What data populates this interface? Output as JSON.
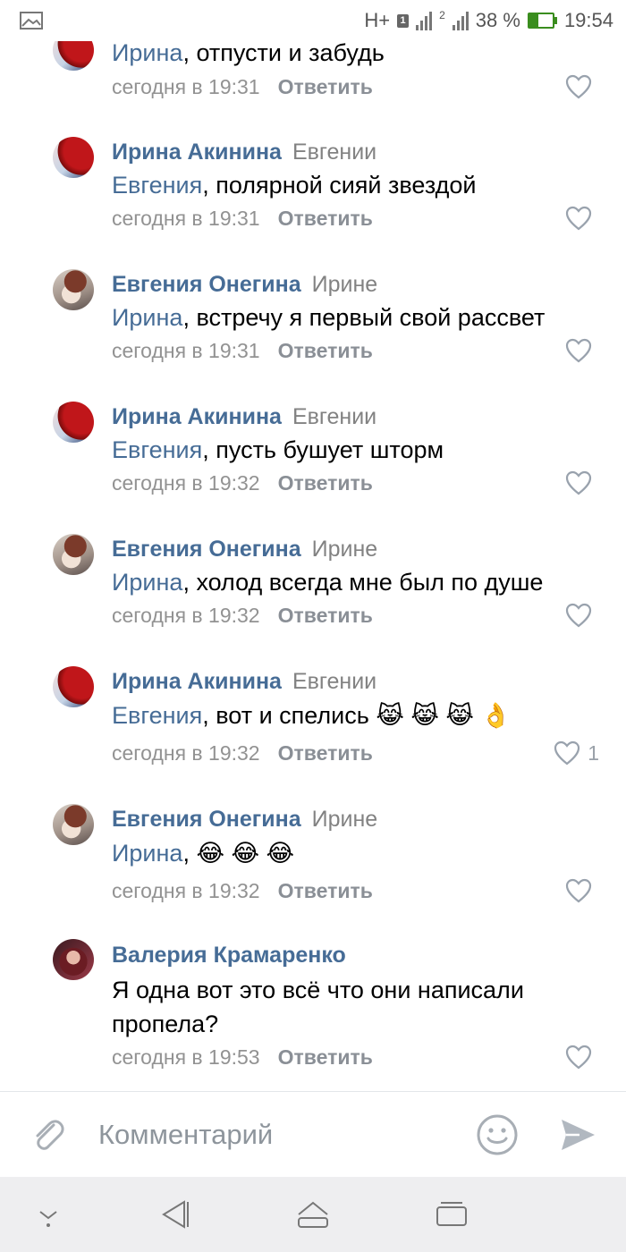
{
  "status_bar": {
    "network": "H+",
    "sim1_badge": "1",
    "sim2_label": "2",
    "battery_percent": "38 %",
    "time": "19:54",
    "icons": [
      "image-icon",
      "signal-icon",
      "battery-charging-icon"
    ]
  },
  "comments": [
    {
      "author": "",
      "addressee": "",
      "mention": "Ирина",
      "text": ", отпусти и забудь",
      "time": "сегодня в 19:31",
      "reply": "Ответить",
      "likes": "",
      "avatar": "irina"
    },
    {
      "author": "Ирина Акинина",
      "addressee": "Евгении",
      "mention": "Евгения",
      "text": ", полярной сияй звездой",
      "time": "сегодня в 19:31",
      "reply": "Ответить",
      "likes": "",
      "avatar": "irina"
    },
    {
      "author": "Евгения Онегина",
      "addressee": "Ирине",
      "mention": "Ирина",
      "text": ", встречу я первый свой рассвет",
      "time": "сегодня в 19:31",
      "reply": "Ответить",
      "likes": "",
      "avatar": "evgenia"
    },
    {
      "author": "Ирина Акинина",
      "addressee": "Евгении",
      "mention": "Евгения",
      "text": ", пусть бушует шторм",
      "time": "сегодня в 19:32",
      "reply": "Ответить",
      "likes": "",
      "avatar": "irina"
    },
    {
      "author": "Евгения Онегина",
      "addressee": "Ирине",
      "mention": "Ирина",
      "text": ", холод всегда мне был по душе",
      "time": "сегодня в 19:32",
      "reply": "Ответить",
      "likes": "",
      "avatar": "evgenia"
    },
    {
      "author": "Ирина Акинина",
      "addressee": "Евгении",
      "mention": "Евгения",
      "text": ", вот и спелись 😹 😹 😹 👌",
      "time": "сегодня в 19:32",
      "reply": "Ответить",
      "likes": "1",
      "avatar": "irina"
    },
    {
      "author": "Евгения Онегина",
      "addressee": "Ирине",
      "mention": "Ирина",
      "text": ", 😂 😂 😂",
      "time": "сегодня в 19:32",
      "reply": "Ответить",
      "likes": "",
      "avatar": "evgenia"
    },
    {
      "author": "Валерия Крамаренко",
      "addressee": "",
      "mention": "",
      "text": "Я одна вот это всё что они написали пропела?",
      "time": "сегодня в 19:53",
      "reply": "Ответить",
      "likes": "",
      "avatar": "valeria"
    }
  ],
  "composer": {
    "placeholder": "Комментарий",
    "icons": [
      "paperclip-icon",
      "emoji-icon",
      "send-icon"
    ]
  },
  "navbar": {
    "icons": [
      "hide-keyboard-icon",
      "back-icon",
      "home-icon",
      "recents-icon"
    ]
  }
}
